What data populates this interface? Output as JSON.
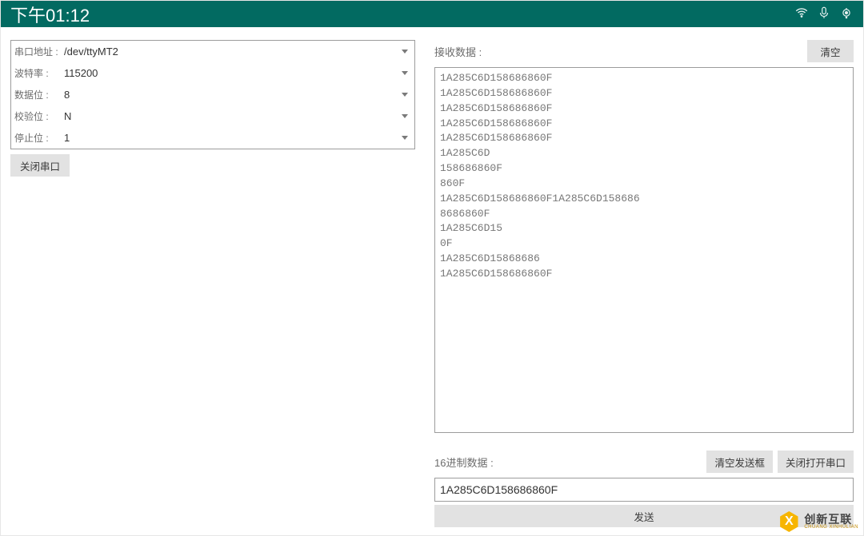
{
  "statusbar": {
    "time": "下午01:12"
  },
  "config": {
    "serial_addr": {
      "label": "串口地址 :",
      "value": "/dev/ttyMT2"
    },
    "baud_rate": {
      "label": "波特率 :",
      "value": "115200"
    },
    "data_bits": {
      "label": "数据位 :",
      "value": "8"
    },
    "parity": {
      "label": "校验位 :",
      "value": "N"
    },
    "stop_bits": {
      "label": "停止位 :",
      "value": "1"
    }
  },
  "buttons": {
    "close_serial": "关闭串口",
    "clear": "清空",
    "clear_send": "清空发送框",
    "toggle_serial": "关闭打开串口",
    "send": "发送"
  },
  "labels": {
    "receive": "接收数据 :",
    "hex_data": "16进制数据 :"
  },
  "receive_data": "1A285C6D158686860F\n1A285C6D158686860F\n1A285C6D158686860F\n1A285C6D158686860F\n1A285C6D158686860F\n1A285C6D\n158686860F\n860F\n1A285C6D158686860F1A285C6D158686\n8686860F\n1A285C6D15\n0F\n1A285C6D15868686\n1A285C6D158686860F",
  "send_input": {
    "value": "1A285C6D158686860F"
  },
  "watermark": {
    "cn": "创新互联",
    "en": "CHUANG XINHULIAN"
  }
}
